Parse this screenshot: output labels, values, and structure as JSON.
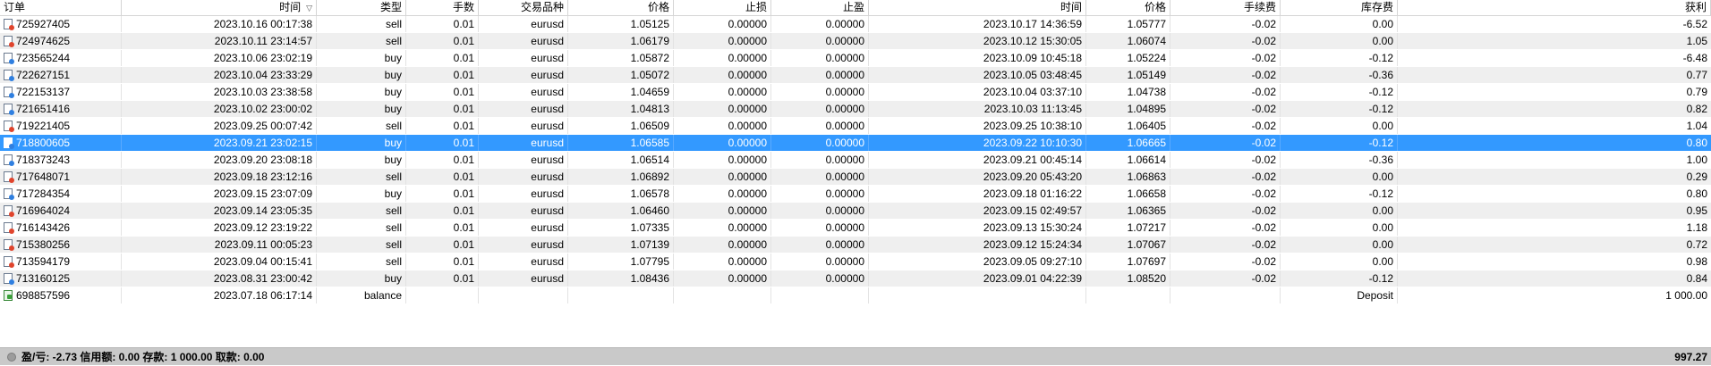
{
  "columns": {
    "order": "订单",
    "time": "时间",
    "type": "类型",
    "lots": "手数",
    "symbol": "交易品种",
    "price": "价格",
    "sl": "止损",
    "tp": "止盈",
    "close_time": "时间",
    "close_price": "价格",
    "commission": "手续费",
    "swap": "库存费",
    "profit": "获利",
    "sort_indicator": "▽"
  },
  "rows": [
    {
      "order": "725927405",
      "time": "2023.10.16 00:17:38",
      "type": "sell",
      "lots": "0.01",
      "symbol": "eurusd",
      "price": "1.05125",
      "sl": "0.00000",
      "tp": "0.00000",
      "close_time": "2023.10.17 14:36:59",
      "close_price": "1.05777",
      "commission": "-0.02",
      "swap": "0.00",
      "profit": "-6.52"
    },
    {
      "order": "724974625",
      "time": "2023.10.11 23:14:57",
      "type": "sell",
      "lots": "0.01",
      "symbol": "eurusd",
      "price": "1.06179",
      "sl": "0.00000",
      "tp": "0.00000",
      "close_time": "2023.10.12 15:30:05",
      "close_price": "1.06074",
      "commission": "-0.02",
      "swap": "0.00",
      "profit": "1.05"
    },
    {
      "order": "723565244",
      "time": "2023.10.06 23:02:19",
      "type": "buy",
      "lots": "0.01",
      "symbol": "eurusd",
      "price": "1.05872",
      "sl": "0.00000",
      "tp": "0.00000",
      "close_time": "2023.10.09 10:45:18",
      "close_price": "1.05224",
      "commission": "-0.02",
      "swap": "-0.12",
      "profit": "-6.48"
    },
    {
      "order": "722627151",
      "time": "2023.10.04 23:33:29",
      "type": "buy",
      "lots": "0.01",
      "symbol": "eurusd",
      "price": "1.05072",
      "sl": "0.00000",
      "tp": "0.00000",
      "close_time": "2023.10.05 03:48:45",
      "close_price": "1.05149",
      "commission": "-0.02",
      "swap": "-0.36",
      "profit": "0.77"
    },
    {
      "order": "722153137",
      "time": "2023.10.03 23:38:58",
      "type": "buy",
      "lots": "0.01",
      "symbol": "eurusd",
      "price": "1.04659",
      "sl": "0.00000",
      "tp": "0.00000",
      "close_time": "2023.10.04 03:37:10",
      "close_price": "1.04738",
      "commission": "-0.02",
      "swap": "-0.12",
      "profit": "0.79"
    },
    {
      "order": "721651416",
      "time": "2023.10.02 23:00:02",
      "type": "buy",
      "lots": "0.01",
      "symbol": "eurusd",
      "price": "1.04813",
      "sl": "0.00000",
      "tp": "0.00000",
      "close_time": "2023.10.03 11:13:45",
      "close_price": "1.04895",
      "commission": "-0.02",
      "swap": "-0.12",
      "profit": "0.82"
    },
    {
      "order": "719221405",
      "time": "2023.09.25 00:07:42",
      "type": "sell",
      "lots": "0.01",
      "symbol": "eurusd",
      "price": "1.06509",
      "sl": "0.00000",
      "tp": "0.00000",
      "close_time": "2023.09.25 10:38:10",
      "close_price": "1.06405",
      "commission": "-0.02",
      "swap": "0.00",
      "profit": "1.04"
    },
    {
      "order": "718800605",
      "time": "2023.09.21 23:02:15",
      "type": "buy",
      "lots": "0.01",
      "symbol": "eurusd",
      "price": "1.06585",
      "sl": "0.00000",
      "tp": "0.00000",
      "close_time": "2023.09.22 10:10:30",
      "close_price": "1.06665",
      "commission": "-0.02",
      "swap": "-0.12",
      "profit": "0.80",
      "selected": true
    },
    {
      "order": "718373243",
      "time": "2023.09.20 23:08:18",
      "type": "buy",
      "lots": "0.01",
      "symbol": "eurusd",
      "price": "1.06514",
      "sl": "0.00000",
      "tp": "0.00000",
      "close_time": "2023.09.21 00:45:14",
      "close_price": "1.06614",
      "commission": "-0.02",
      "swap": "-0.36",
      "profit": "1.00"
    },
    {
      "order": "717648071",
      "time": "2023.09.18 23:12:16",
      "type": "sell",
      "lots": "0.01",
      "symbol": "eurusd",
      "price": "1.06892",
      "sl": "0.00000",
      "tp": "0.00000",
      "close_time": "2023.09.20 05:43:20",
      "close_price": "1.06863",
      "commission": "-0.02",
      "swap": "0.00",
      "profit": "0.29"
    },
    {
      "order": "717284354",
      "time": "2023.09.15 23:07:09",
      "type": "buy",
      "lots": "0.01",
      "symbol": "eurusd",
      "price": "1.06578",
      "sl": "0.00000",
      "tp": "0.00000",
      "close_time": "2023.09.18 01:16:22",
      "close_price": "1.06658",
      "commission": "-0.02",
      "swap": "-0.12",
      "profit": "0.80"
    },
    {
      "order": "716964024",
      "time": "2023.09.14 23:05:35",
      "type": "sell",
      "lots": "0.01",
      "symbol": "eurusd",
      "price": "1.06460",
      "sl": "0.00000",
      "tp": "0.00000",
      "close_time": "2023.09.15 02:49:57",
      "close_price": "1.06365",
      "commission": "-0.02",
      "swap": "0.00",
      "profit": "0.95"
    },
    {
      "order": "716143426",
      "time": "2023.09.12 23:19:22",
      "type": "sell",
      "lots": "0.01",
      "symbol": "eurusd",
      "price": "1.07335",
      "sl": "0.00000",
      "tp": "0.00000",
      "close_time": "2023.09.13 15:30:24",
      "close_price": "1.07217",
      "commission": "-0.02",
      "swap": "0.00",
      "profit": "1.18"
    },
    {
      "order": "715380256",
      "time": "2023.09.11 00:05:23",
      "type": "sell",
      "lots": "0.01",
      "symbol": "eurusd",
      "price": "1.07139",
      "sl": "0.00000",
      "tp": "0.00000",
      "close_time": "2023.09.12 15:24:34",
      "close_price": "1.07067",
      "commission": "-0.02",
      "swap": "0.00",
      "profit": "0.72"
    },
    {
      "order": "713594179",
      "time": "2023.09.04 00:15:41",
      "type": "sell",
      "lots": "0.01",
      "symbol": "eurusd",
      "price": "1.07795",
      "sl": "0.00000",
      "tp": "0.00000",
      "close_time": "2023.09.05 09:27:10",
      "close_price": "1.07697",
      "commission": "-0.02",
      "swap": "0.00",
      "profit": "0.98"
    },
    {
      "order": "713160125",
      "time": "2023.08.31 23:00:42",
      "type": "buy",
      "lots": "0.01",
      "symbol": "eurusd",
      "price": "1.08436",
      "sl": "0.00000",
      "tp": "0.00000",
      "close_time": "2023.09.01 04:22:39",
      "close_price": "1.08520",
      "commission": "-0.02",
      "swap": "-0.12",
      "profit": "0.84"
    },
    {
      "order": "698857596",
      "time": "2023.07.18 06:17:14",
      "type": "balance",
      "lots": "",
      "symbol": "",
      "price": "",
      "sl": "",
      "tp": "",
      "close_time": "",
      "close_price": "",
      "commission": "",
      "swap": "Deposit",
      "profit": "1 000.00"
    }
  ],
  "footer": {
    "summary": "盈/亏: -2.73  信用额: 0.00  存款: 1 000.00  取款: 0.00",
    "total": "997.27"
  },
  "colors": {
    "selected_row": "#3399ff",
    "alt_row": "#efefef",
    "footer_bg": "#c9c9c9",
    "sell_icon": "#e0442c",
    "buy_icon": "#2f7fe0",
    "balance_icon": "#3aa23a"
  }
}
